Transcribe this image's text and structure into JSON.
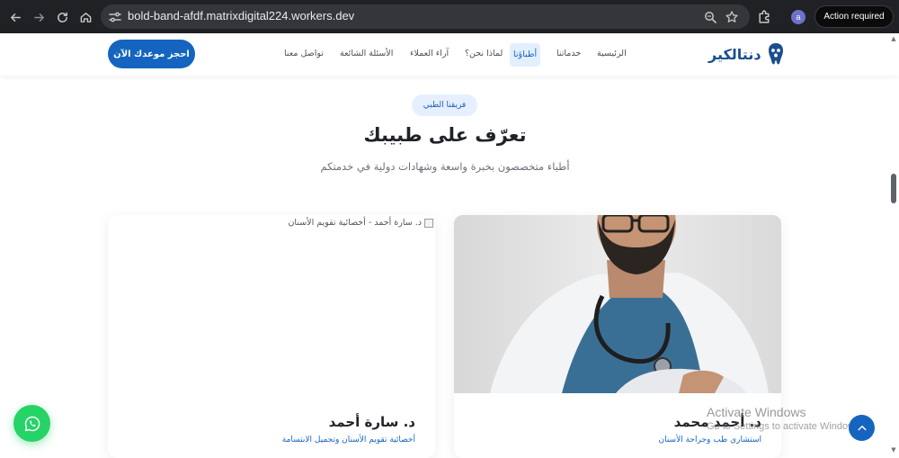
{
  "browser": {
    "url": "bold-band-afdf.matrixdigital224.workers.dev",
    "profile_initial": "a",
    "action_label": "Action required"
  },
  "header": {
    "logo_text": "دنتالكير",
    "book_button": "احجز موعدك الآن",
    "nav": [
      {
        "label": "الرئيسية"
      },
      {
        "label": "خدماتنا"
      },
      {
        "label": "أطباؤنا",
        "active": true
      },
      {
        "label": "لماذا نحن؟"
      },
      {
        "label": "آراء العملاء"
      },
      {
        "label": "الأسئلة الشائعة"
      },
      {
        "label": "تواصل معنا"
      }
    ]
  },
  "section": {
    "badge": "فريقنا الطبي",
    "title": "تعرّف على طبيبك",
    "subtitle": "أطباء متخصصون بخبرة واسعة وشهادات دولية في خدمتكم"
  },
  "doctors": [
    {
      "name": "د. أحمد محمد",
      "role": "استشاري طب وجراحة الأسنان"
    },
    {
      "name": "د. سارة أحمد",
      "role": "أخصائية تقويم الأسنان وتجميل الابتسامة",
      "image_alt": "د. سارة أحمد - أخصائية تقويم الأسنان"
    }
  ],
  "watermark": {
    "title": "Activate Windows",
    "subtitle": "Go to Settings to activate Windows."
  },
  "colors": {
    "primary": "#1565c0",
    "whatsapp": "#25d366",
    "browser_bg": "#202124"
  },
  "icons": {
    "back": "arrow-left-icon",
    "forward": "arrow-right-icon",
    "reload": "reload-icon",
    "home": "home-icon",
    "site_info": "tune-icon",
    "zoom": "magnifier-icon",
    "bookmark": "star-icon",
    "extensions": "puzzle-icon",
    "whatsapp": "whatsapp-icon",
    "scroll_top": "chevron-up-icon"
  }
}
